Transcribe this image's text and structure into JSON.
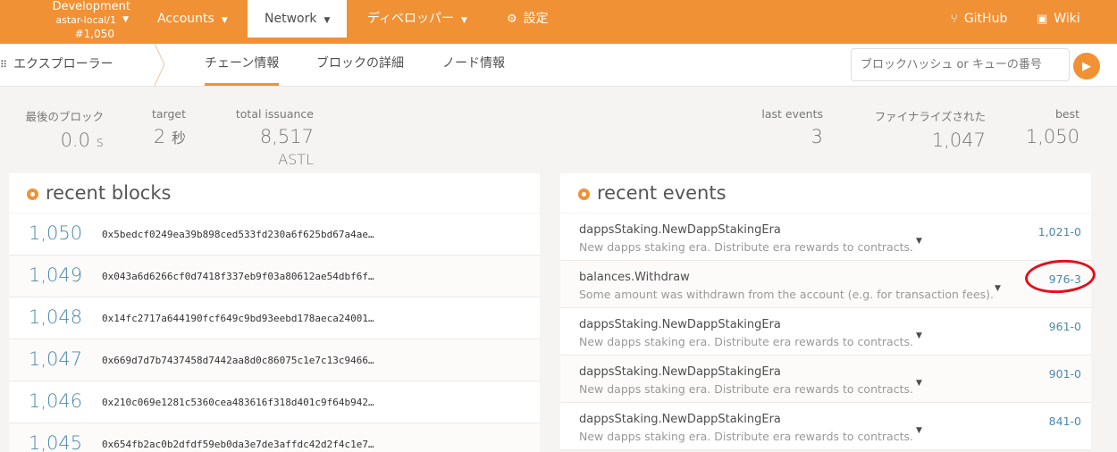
{
  "topbar": {
    "chain_name": "Development",
    "chain_spec": "astar-local/1",
    "block_number": "#1,050",
    "nav": {
      "accounts": "Accounts",
      "network": "Network",
      "developer": "ディベロッパー",
      "settings": "設定",
      "github": "GitHub",
      "wiki": "Wiki"
    }
  },
  "subbar": {
    "section": "エクスプローラー",
    "tabs": [
      "チェーン情報",
      "ブロックの詳細",
      "ノード情報"
    ],
    "search_placeholder": "ブロックハッシュ or キューの番号"
  },
  "summary": {
    "last_block": {
      "label": "最後のブロック",
      "value": "0.0",
      "unit": "s"
    },
    "target": {
      "label": "target",
      "value": "2",
      "unit": "秒"
    },
    "total_issuance": {
      "label": "total issuance",
      "value": "8,517",
      "unit": "ASTL"
    },
    "last_events": {
      "label": "last events",
      "value": "3"
    },
    "finalized": {
      "label": "ファイナライズされた",
      "value": "1,047"
    },
    "best": {
      "label": "best",
      "value": "1,050"
    }
  },
  "recent_blocks": {
    "title": "recent blocks",
    "rows": [
      {
        "number": "1,050",
        "hash": "0x5bedcf0249ea39b898ced533fd230a6f625bd67a4ae…"
      },
      {
        "number": "1,049",
        "hash": "0x043a6d6266cf0d7418f337eb9f03a80612ae54dbf6f…"
      },
      {
        "number": "1,048",
        "hash": "0x14fc2717a644190fcf649c9bd93eebd178aeca24001…"
      },
      {
        "number": "1,047",
        "hash": "0x669d7d7b7437458d7442aa8d0c86075c1e7c13c9466…"
      },
      {
        "number": "1,046",
        "hash": "0x210c069e1281c5360cea483616f318d401c9f64b942…"
      },
      {
        "number": "1,045",
        "hash": "0x654fb2ac0b2dfdf59eb0da3e7de3affdc42d2f4c1e7…"
      }
    ]
  },
  "recent_events": {
    "title": "recent events",
    "rows": [
      {
        "name": "dappsStaking.NewDappStakingEra",
        "desc": "New dapps staking era. Distribute era rewards to contracts.",
        "link": "1,021-0"
      },
      {
        "name": "balances.Withdraw",
        "desc": "Some amount was withdrawn from the account (e.g. for transaction fees).",
        "link": "976-3"
      },
      {
        "name": "dappsStaking.NewDappStakingEra",
        "desc": "New dapps staking era. Distribute era rewards to contracts.",
        "link": "961-0"
      },
      {
        "name": "dappsStaking.NewDappStakingEra",
        "desc": "New dapps staking era. Distribute era rewards to contracts.",
        "link": "901-0"
      },
      {
        "name": "dappsStaking.NewDappStakingEra",
        "desc": "New dapps staking era. Distribute era rewards to contracts.",
        "link": "841-0"
      }
    ]
  },
  "colors": {
    "accent": "#f19135",
    "link": "#4b89ad",
    "highlight": "#e0101c"
  }
}
